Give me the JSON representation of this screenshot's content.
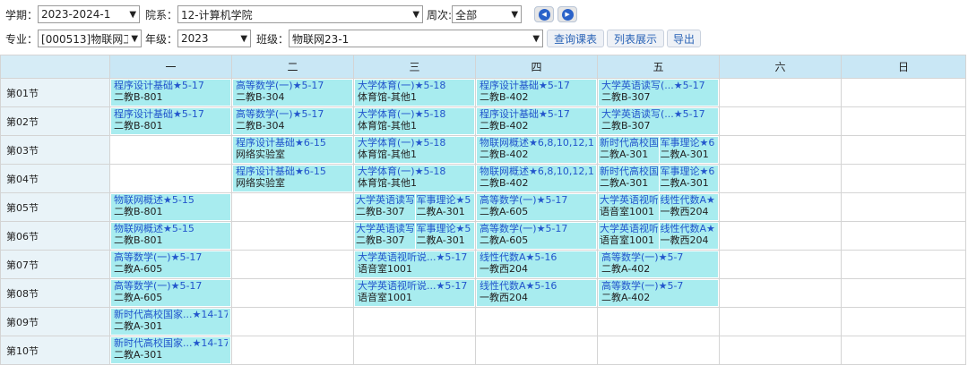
{
  "filters": {
    "term_label": "学期：",
    "term_value": "2023-2024-1",
    "dept_label": "院系：",
    "dept_value": "12-计算机学院",
    "week_label": "周次:",
    "week_value": "全部",
    "major_label": "专业：",
    "major_value": "[000513]物联网工",
    "grade_label": "年级：",
    "grade_value": "2023",
    "class_label": "班级：",
    "class_value": "物联网23-1",
    "query_button": "查询课表",
    "list_button": "列表展示",
    "export_button": "导出"
  },
  "timetable": {
    "days": [
      "一",
      "二",
      "三",
      "四",
      "五",
      "六",
      "日"
    ],
    "periods": [
      "第01节",
      "第02节",
      "第03节",
      "第04节",
      "第05节",
      "第06节",
      "第07节",
      "第08节",
      "第09节",
      "第10节"
    ],
    "rows": [
      [
        [
          {
            "name": "程序设计基础★5-17",
            "room": "二教B-801"
          }
        ],
        [
          {
            "name": "高等数学(一)★5-17",
            "room": "二教B-304"
          }
        ],
        [
          {
            "name": "大学体育(一)★5-18",
            "room": "体育馆-其他1"
          }
        ],
        [
          {
            "name": "程序设计基础★5-17",
            "room": "二教B-402"
          }
        ],
        [
          {
            "name": "大学英语读写(...★5-17",
            "room": "二教B-307"
          }
        ],
        [],
        []
      ],
      [
        [
          {
            "name": "程序设计基础★5-17",
            "room": "二教B-801"
          }
        ],
        [
          {
            "name": "高等数学(一)★5-17",
            "room": "二教B-304"
          }
        ],
        [
          {
            "name": "大学体育(一)★5-18",
            "room": "体育馆-其他1"
          }
        ],
        [
          {
            "name": "程序设计基础★5-17",
            "room": "二教B-402"
          }
        ],
        [
          {
            "name": "大学英语读写(...★5-17",
            "room": "二教B-307"
          }
        ],
        [],
        []
      ],
      [
        [],
        [
          {
            "name": "程序设计基础★6-15",
            "room": "网络实验室"
          }
        ],
        [
          {
            "name": "大学体育(一)★5-18",
            "room": "体育馆-其他1"
          }
        ],
        [
          {
            "name": "物联网概述★6,8,10,12,14",
            "room": "二教B-402"
          }
        ],
        [
          {
            "name": "新时代高校国家...",
            "room": "二教A-301"
          },
          {
            "name": "军事理论★6",
            "room": "二教A-301"
          }
        ],
        [],
        []
      ],
      [
        [],
        [
          {
            "name": "程序设计基础★6-15",
            "room": "网络实验室"
          }
        ],
        [
          {
            "name": "大学体育(一)★5-18",
            "room": "体育馆-其他1"
          }
        ],
        [
          {
            "name": "物联网概述★6,8,10,12,14",
            "room": "二教B-402"
          }
        ],
        [
          {
            "name": "新时代高校国家...",
            "room": "二教A-301"
          },
          {
            "name": "军事理论★6",
            "room": "二教A-301"
          }
        ],
        [],
        []
      ],
      [
        [
          {
            "name": "物联网概述★5-15",
            "room": "二教B-801"
          }
        ],
        [],
        [
          {
            "name": "大学英语读写(...",
            "room": "二教B-307"
          },
          {
            "name": "军事理论★5",
            "room": "二教A-301"
          }
        ],
        [
          {
            "name": "高等数学(一)★5-17",
            "room": "二教A-605"
          }
        ],
        [
          {
            "name": "大学英语视听说...",
            "room": "语音室1001"
          },
          {
            "name": "线性代数A★",
            "room": "一教西204"
          }
        ],
        [],
        []
      ],
      [
        [
          {
            "name": "物联网概述★5-15",
            "room": "二教B-801"
          }
        ],
        [],
        [
          {
            "name": "大学英语读写(...",
            "room": "二教B-307"
          },
          {
            "name": "军事理论★5",
            "room": "二教A-301"
          }
        ],
        [
          {
            "name": "高等数学(一)★5-17",
            "room": "二教A-605"
          }
        ],
        [
          {
            "name": "大学英语视听说...",
            "room": "语音室1001"
          },
          {
            "name": "线性代数A★",
            "room": "一教西204"
          }
        ],
        [],
        []
      ],
      [
        [
          {
            "name": "高等数学(一)★5-17",
            "room": "二教A-605"
          }
        ],
        [],
        [
          {
            "name": "大学英语视听说...★5-17",
            "room": "语音室1001"
          }
        ],
        [
          {
            "name": "线性代数A★5-16",
            "room": "一教西204"
          }
        ],
        [
          {
            "name": "高等数学(一)★5-7",
            "room": "二教A-402"
          }
        ],
        [],
        []
      ],
      [
        [
          {
            "name": "高等数学(一)★5-17",
            "room": "二教A-605"
          }
        ],
        [],
        [
          {
            "name": "大学英语视听说...★5-17",
            "room": "语音室1001"
          }
        ],
        [
          {
            "name": "线性代数A★5-16",
            "room": "一教西204"
          }
        ],
        [
          {
            "name": "高等数学(一)★5-7",
            "room": "二教A-402"
          }
        ],
        [],
        []
      ],
      [
        [
          {
            "name": "新时代高校国家...★14-17",
            "room": "二教A-301"
          }
        ],
        [],
        [],
        [],
        [],
        [],
        []
      ],
      [
        [
          {
            "name": "新时代高校国家...★14-17",
            "room": "二教A-301"
          }
        ],
        [],
        [],
        [],
        [],
        [],
        []
      ]
    ]
  }
}
